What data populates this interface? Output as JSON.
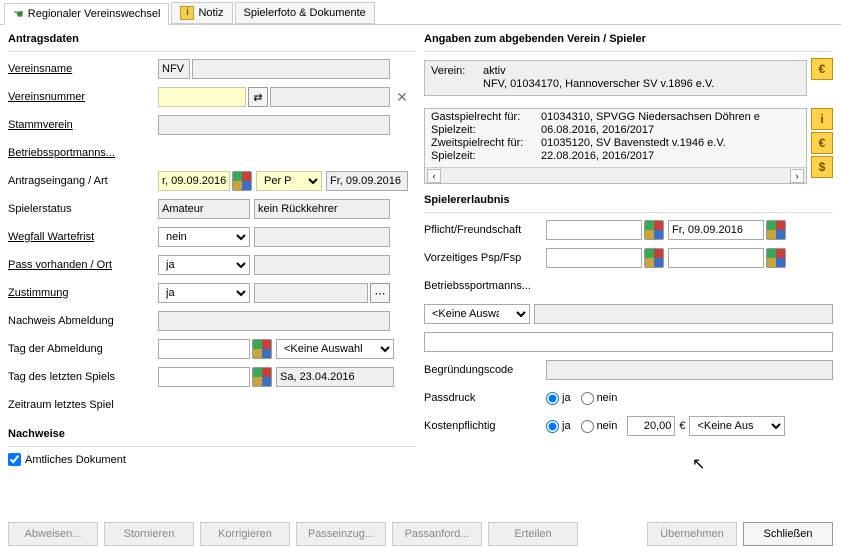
{
  "tabs": {
    "regional": "Regionaler Vereinswechsel",
    "notiz": "Notiz",
    "foto": "Spielerfoto & Dokumente"
  },
  "left": {
    "title": "Antragsdaten",
    "vereinsname_label": "Vereinsname",
    "vereinsname_code": "NFV",
    "vereinsnummer_label": "Vereinsnummer",
    "vereinsnummer_value": "",
    "vereinsnummer_secondary": "",
    "stammverein_label": "Stammverein",
    "stammverein_value": "",
    "betriebs_label": "Betriebssportmanns...",
    "eingang_label": "Antragseingang / Art",
    "eingang_date_1": "r, 09.09.2016",
    "eingang_art": "Per Post",
    "eingang_date_2": "Fr, 09.09.2016",
    "spielerstatus_label": "Spielerstatus",
    "spielerstatus_1": "Amateur",
    "spielerstatus_2": "kein Rückkehrer",
    "wegfall_label": "Wegfall Wartefrist",
    "wegfall_val": "nein",
    "pass_label": "Pass vorhanden / Ort",
    "pass_val": "ja",
    "zust_label": "Zustimmung",
    "zust_val": "ja",
    "nachweis_label": "Nachweis Abmeldung",
    "tag_abm_label": "Tag der Abmeldung",
    "tag_abm_sel": "<Keine Auswahl>",
    "tag_spiel_label": "Tag des letzten Spiels",
    "tag_spiel_val": "Sa, 23.04.2016",
    "zeitraum_label": "Zeitraum letztes Spiel"
  },
  "right": {
    "title": "Angaben zum abgebenden Verein / Spieler",
    "verein_k": "Verein:",
    "verein_status": "aktiv",
    "verein_line": "NFV, 01034170, Hannoverscher SV v.1896 e.V.",
    "gast_k": "Gastspielrecht für:",
    "gast_v": "01034310, SPVGG Niedersachsen Döhren e",
    "spiel1_k": "Spielzeit:",
    "spiel1_v": "06.08.2016, 2016/2017",
    "zweit_k": "Zweitspielrecht für:",
    "zweit_v": "01035120, SV Bavenstedt v.1946 e.V.",
    "spiel2_k": "Spielzeit:",
    "spiel2_v": "22.08.2016, 2016/2017",
    "erlaubnis_title": "Spielererlaubnis",
    "pflicht_label": "Pflicht/Freundschaft",
    "pflicht_date": "Fr, 09.09.2016",
    "vorz_label": "Vorzeitiges Psp/Fsp",
    "betriebs_label": "Betriebssportmanns...",
    "betriebs_sel": "<Keine Auswa...",
    "begr_label": "Begründungscode",
    "pass_label": "Passdruck",
    "kost_label": "Kostenpflichtig",
    "kost_amount": "20,00",
    "euro": "€",
    "kost_sel": "<Keine Aus...",
    "radio_ja": "ja",
    "radio_nein": "nein"
  },
  "nachweise": {
    "title": "Nachweise",
    "amtlich": "Amtliches Dokument"
  },
  "buttons": {
    "abweisen": "Abweisen...",
    "storn": "Stornieren",
    "korr": "Korrigieren",
    "pass": "Passeinzug...",
    "passanf": "Passanford...",
    "erteilen": "Erteilen",
    "ueber": "Übernehmen",
    "schliessen": "Schließen"
  },
  "icons": {
    "info": "i",
    "euro": "€",
    "dollar": "$"
  }
}
